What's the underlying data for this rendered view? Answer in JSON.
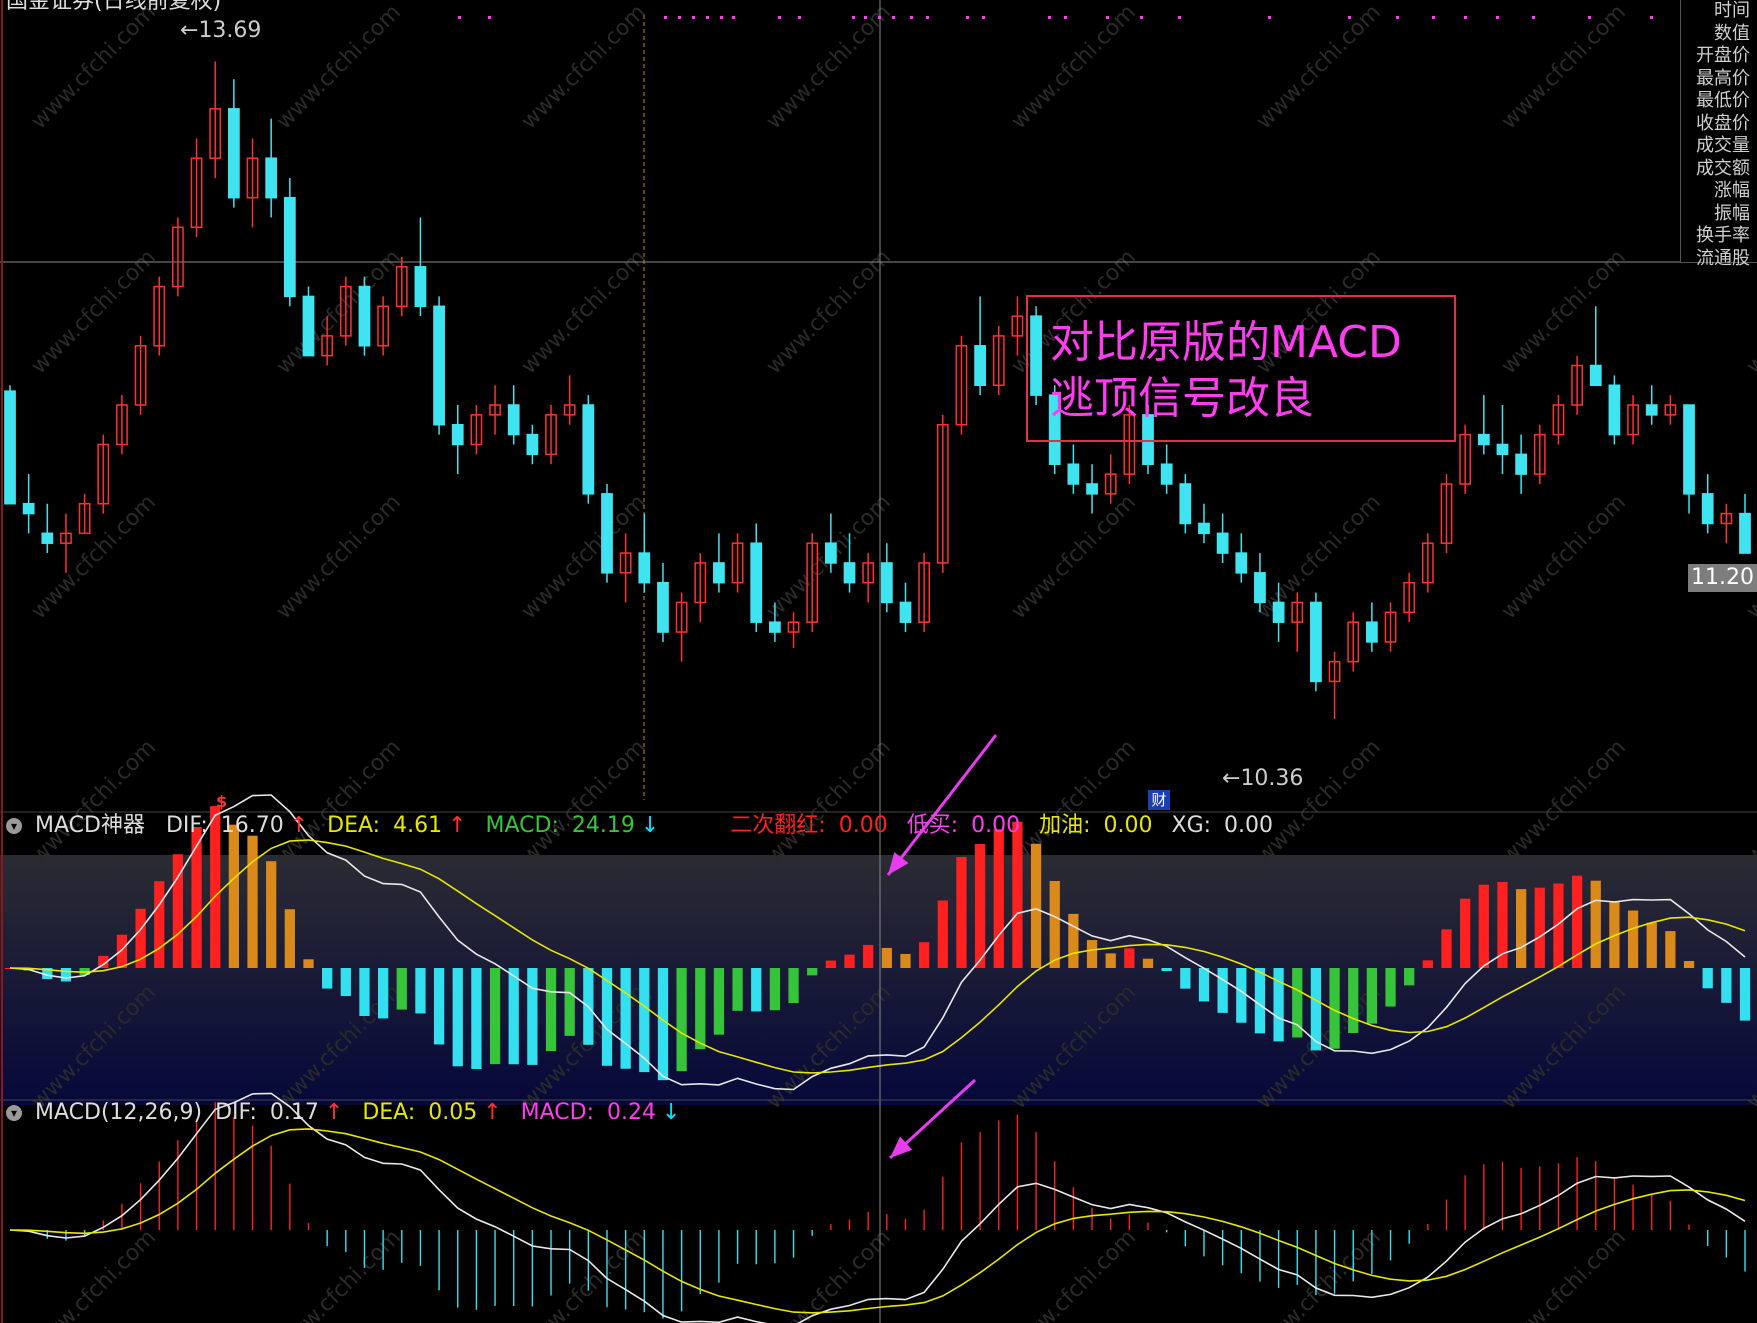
{
  "header": {
    "stock_name": "国金证券(日线前复权)"
  },
  "price_labels": {
    "high": "13.69",
    "low": "10.36",
    "last": "11.20"
  },
  "event_markers": {
    "marker_s": "$",
    "marker_cai": "财"
  },
  "side_panel": {
    "items": [
      "时间",
      "数值",
      "开盘价",
      "最高价",
      "最低价",
      "收盘价",
      "成交量",
      "成交额",
      "涨幅",
      "振幅",
      "换手率",
      "流通股"
    ]
  },
  "annotation": {
    "line1": "对比原版的MACD",
    "line2": "逃顶信号改良"
  },
  "indicator1": {
    "name": "MACD神器",
    "dif_label": "DIF:",
    "dif_value": "16.70",
    "dea_label": "DEA:",
    "dea_value": "4.61",
    "macd_label": "MACD:",
    "macd_value": "24.19",
    "ecfh_label": "二次翻红:",
    "ecfh_value": "0.00",
    "dimai_label": "低买:",
    "dimai_value": "0.00",
    "jiacang_label": "加油:",
    "jiacang_value": "0.00",
    "xg_label": "XG:",
    "xg_value": "0.00"
  },
  "indicator2": {
    "name": "MACD(12,26,9)",
    "dif_label": "DIF:",
    "dif_value": "0.17",
    "dea_label": "DEA:",
    "dea_value": "0.05",
    "macd_label": "MACD:",
    "macd_value": "0.24"
  },
  "arrows": {
    "up": "↑",
    "down": "↓"
  },
  "watermark": "www.cfchi.com",
  "colors": {
    "up_candle": "#ff3030",
    "down_candle": "#3fe4f0",
    "dif_line": "#e8e8e8",
    "dea_line": "#e6e600",
    "hist_red": "#ff2020",
    "hist_orange": "#d98a1a",
    "hist_cyan": "#33e0f0",
    "hist_green": "#36c43a",
    "annotation": "#ff3cf0",
    "arrow": "#e83cf0"
  },
  "chart_data": {
    "type": "candlestick",
    "price_range": [
      10.0,
      13.9
    ],
    "candles_ohlc": [
      [
        12.02,
        12.05,
        11.45,
        11.45
      ],
      [
        11.45,
        11.6,
        11.3,
        11.4
      ],
      [
        11.3,
        11.45,
        11.2,
        11.25
      ],
      [
        11.25,
        11.4,
        11.1,
        11.3
      ],
      [
        11.3,
        11.5,
        11.3,
        11.45
      ],
      [
        11.45,
        11.8,
        11.4,
        11.75
      ],
      [
        11.75,
        12.0,
        11.7,
        11.95
      ],
      [
        11.95,
        12.3,
        11.9,
        12.25
      ],
      [
        12.25,
        12.6,
        12.2,
        12.55
      ],
      [
        12.55,
        12.9,
        12.5,
        12.85
      ],
      [
        12.85,
        13.3,
        12.8,
        13.2
      ],
      [
        13.2,
        13.69,
        13.1,
        13.45
      ],
      [
        13.45,
        13.6,
        12.95,
        13.0
      ],
      [
        13.0,
        13.3,
        12.85,
        13.2
      ],
      [
        13.2,
        13.4,
        12.9,
        13.0
      ],
      [
        13.0,
        13.1,
        12.45,
        12.5
      ],
      [
        12.5,
        12.55,
        12.2,
        12.2
      ],
      [
        12.2,
        12.4,
        12.15,
        12.3
      ],
      [
        12.3,
        12.6,
        12.25,
        12.55
      ],
      [
        12.55,
        12.6,
        12.2,
        12.25
      ],
      [
        12.25,
        12.5,
        12.2,
        12.45
      ],
      [
        12.45,
        12.7,
        12.4,
        12.65
      ],
      [
        12.65,
        12.9,
        12.4,
        12.45
      ],
      [
        12.45,
        12.5,
        11.8,
        11.85
      ],
      [
        11.85,
        11.95,
        11.6,
        11.75
      ],
      [
        11.75,
        11.95,
        11.7,
        11.9
      ],
      [
        11.9,
        12.05,
        11.8,
        11.95
      ],
      [
        11.95,
        12.05,
        11.75,
        11.8
      ],
      [
        11.8,
        11.85,
        11.65,
        11.7
      ],
      [
        11.7,
        11.95,
        11.65,
        11.9
      ],
      [
        11.9,
        12.1,
        11.85,
        11.95
      ],
      [
        11.95,
        12.0,
        11.45,
        11.5
      ],
      [
        11.5,
        11.55,
        11.05,
        11.1
      ],
      [
        11.1,
        11.3,
        10.95,
        11.2
      ],
      [
        11.2,
        11.4,
        11.0,
        11.05
      ],
      [
        11.05,
        11.15,
        10.75,
        10.8
      ],
      [
        10.8,
        11.0,
        10.65,
        10.95
      ],
      [
        10.95,
        11.2,
        10.85,
        11.15
      ],
      [
        11.15,
        11.3,
        11.0,
        11.05
      ],
      [
        11.05,
        11.3,
        11.0,
        11.25
      ],
      [
        11.25,
        11.35,
        10.8,
        10.85
      ],
      [
        10.85,
        10.95,
        10.75,
        10.8
      ],
      [
        10.8,
        10.9,
        10.72,
        10.85
      ],
      [
        10.85,
        11.3,
        10.8,
        11.25
      ],
      [
        11.25,
        11.4,
        11.1,
        11.15
      ],
      [
        11.15,
        11.3,
        11.0,
        11.05
      ],
      [
        11.05,
        11.2,
        10.95,
        11.15
      ],
      [
        11.15,
        11.25,
        10.9,
        10.95
      ],
      [
        10.95,
        11.05,
        10.8,
        10.85
      ],
      [
        10.85,
        11.2,
        10.8,
        11.15
      ],
      [
        11.15,
        11.9,
        11.1,
        11.85
      ],
      [
        11.85,
        12.3,
        11.8,
        12.25
      ],
      [
        12.25,
        12.5,
        12.0,
        12.05
      ],
      [
        12.05,
        12.35,
        12.0,
        12.3
      ],
      [
        12.3,
        12.5,
        12.2,
        12.4
      ],
      [
        12.4,
        12.45,
        11.95,
        12.0
      ],
      [
        12.0,
        12.05,
        11.6,
        11.65
      ],
      [
        11.65,
        11.75,
        11.5,
        11.55
      ],
      [
        11.55,
        11.65,
        11.4,
        11.5
      ],
      [
        11.5,
        11.7,
        11.45,
        11.6
      ],
      [
        11.6,
        11.95,
        11.55,
        11.9
      ],
      [
        11.9,
        11.95,
        11.6,
        11.65
      ],
      [
        11.65,
        11.75,
        11.5,
        11.55
      ],
      [
        11.55,
        11.6,
        11.3,
        11.35
      ],
      [
        11.35,
        11.45,
        11.25,
        11.3
      ],
      [
        11.3,
        11.4,
        11.15,
        11.2
      ],
      [
        11.2,
        11.3,
        11.05,
        11.1
      ],
      [
        11.1,
        11.2,
        10.9,
        10.95
      ],
      [
        10.95,
        11.05,
        10.75,
        10.85
      ],
      [
        10.85,
        11.0,
        10.7,
        10.95
      ],
      [
        10.95,
        11.0,
        10.5,
        10.55
      ],
      [
        10.55,
        10.7,
        10.36,
        10.65
      ],
      [
        10.65,
        10.9,
        10.6,
        10.85
      ],
      [
        10.85,
        10.95,
        10.7,
        10.75
      ],
      [
        10.75,
        10.95,
        10.7,
        10.9
      ],
      [
        10.9,
        11.1,
        10.85,
        11.05
      ],
      [
        11.05,
        11.3,
        11.0,
        11.25
      ],
      [
        11.25,
        11.6,
        11.2,
        11.55
      ],
      [
        11.55,
        11.85,
        11.5,
        11.8
      ],
      [
        11.8,
        12.0,
        11.7,
        11.75
      ],
      [
        11.75,
        11.95,
        11.6,
        11.7
      ],
      [
        11.7,
        11.8,
        11.5,
        11.6
      ],
      [
        11.6,
        11.85,
        11.55,
        11.8
      ],
      [
        11.8,
        12.0,
        11.75,
        11.95
      ],
      [
        11.95,
        12.2,
        11.9,
        12.15
      ],
      [
        12.15,
        12.45,
        12.1,
        12.05
      ],
      [
        12.05,
        12.1,
        11.75,
        11.8
      ],
      [
        11.8,
        12.0,
        11.75,
        11.95
      ],
      [
        11.95,
        12.05,
        11.85,
        11.9
      ],
      [
        11.9,
        12.0,
        11.85,
        11.95
      ],
      [
        11.95,
        11.95,
        11.4,
        11.5
      ],
      [
        11.5,
        11.6,
        11.3,
        11.35
      ],
      [
        11.35,
        11.45,
        11.25,
        11.4
      ],
      [
        11.4,
        11.5,
        11.3,
        11.2
      ]
    ]
  }
}
